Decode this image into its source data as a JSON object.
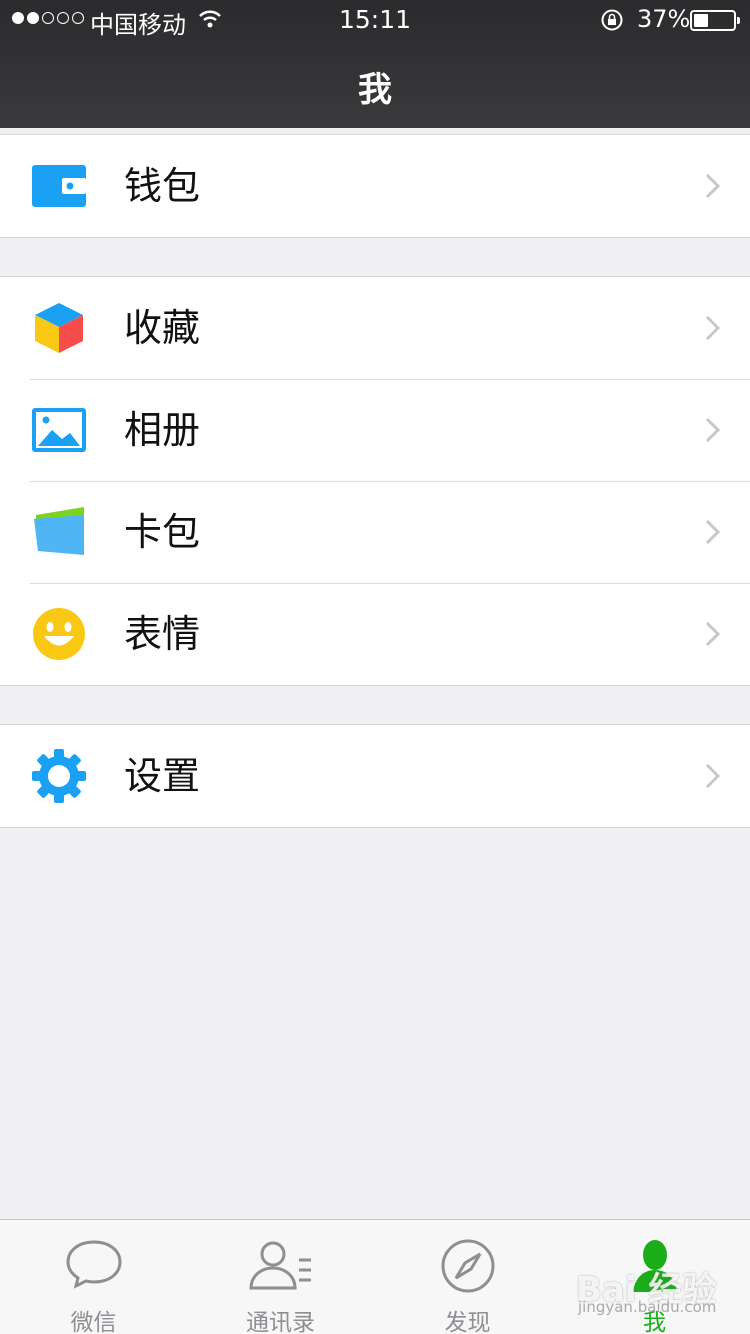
{
  "status": {
    "carrier": "中国移动",
    "time": "15:11",
    "battery_percent": "37%",
    "battery_level": 0.37,
    "signal_bars": 2
  },
  "nav": {
    "title": "我"
  },
  "menu_groups": [
    {
      "items": [
        {
          "label": "钱包",
          "icon": "wallet-icon"
        }
      ]
    },
    {
      "items": [
        {
          "label": "收藏",
          "icon": "favorites-cube-icon"
        },
        {
          "label": "相册",
          "icon": "album-picture-icon"
        },
        {
          "label": "卡包",
          "icon": "card-pack-icon"
        },
        {
          "label": "表情",
          "icon": "emoji-smiley-icon"
        }
      ]
    },
    {
      "items": [
        {
          "label": "设置",
          "icon": "settings-gear-icon"
        }
      ]
    }
  ],
  "tabbar": {
    "tabs": [
      {
        "label": "微信",
        "icon": "chat-bubble-icon",
        "active": false
      },
      {
        "label": "通讯录",
        "icon": "contacts-icon",
        "active": false
      },
      {
        "label": "发现",
        "icon": "compass-icon",
        "active": false
      },
      {
        "label": "我",
        "icon": "me-person-icon",
        "active": true
      }
    ]
  },
  "watermark": {
    "brand": "Bai 经验",
    "url": "jingyan.baidu.com"
  },
  "colors": {
    "accent_green": "#1aad19",
    "icon_blue": "#1aa1f3",
    "background": "#efeff4"
  }
}
